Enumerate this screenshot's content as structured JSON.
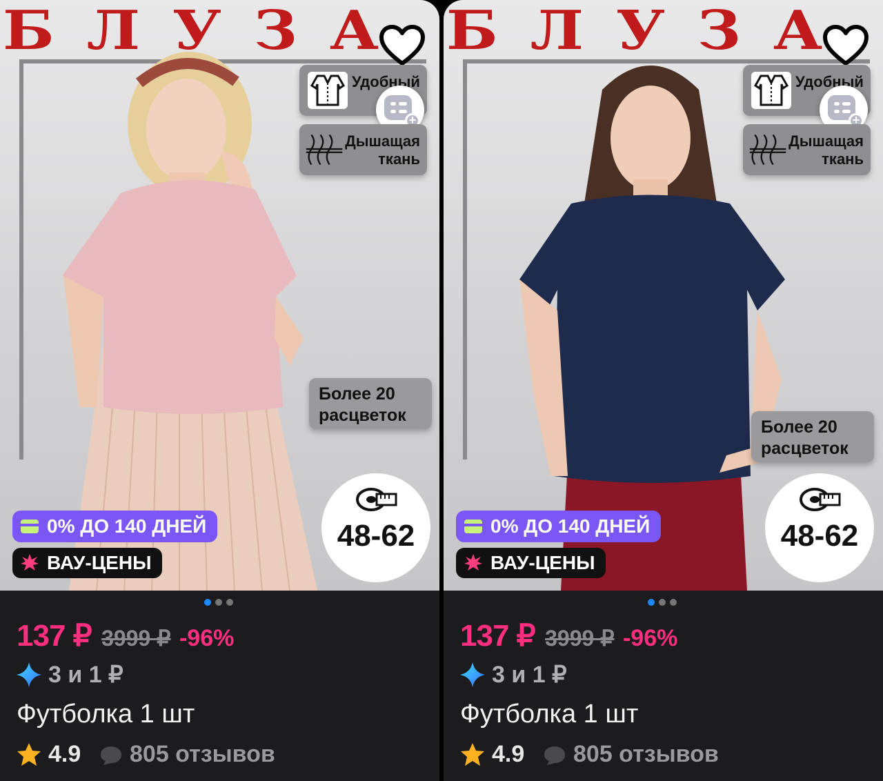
{
  "products": [
    {
      "banner_title": "БЛУЗА",
      "feature_1": "Удобный",
      "feature_2_line1": "Дышащая",
      "feature_2_line2": "ткань",
      "colors_line1": "Более 20",
      "colors_line2": "расцветок",
      "size_range": "48-62",
      "installment": "0% ДО 140 ДНЕЙ",
      "promo": "ВАУ-ЦЕНЫ",
      "price": "137 ₽",
      "old_price": "3999 ₽",
      "discount": "-96%",
      "split": "3 и 1 ₽",
      "name": "Футболка 1 шт",
      "rating": "4.9",
      "reviews": "805 отзывов",
      "shirt_color": "#e8b9bd",
      "image_index": 0,
      "image_count": 3
    },
    {
      "banner_title": "БЛУЗА",
      "feature_1": "Удобный",
      "feature_2_line1": "Дышащая",
      "feature_2_line2": "ткань",
      "colors_line1": "Более 20",
      "colors_line2": "расцветок",
      "size_range": "48-62",
      "installment": "0% ДО 140 ДНЕЙ",
      "promo": "ВАУ-ЦЕНЫ",
      "price": "137 ₽",
      "old_price": "3999 ₽",
      "discount": "-96%",
      "split": "3 и 1 ₽",
      "name": "Футболка 1 шт",
      "rating": "4.9",
      "reviews": "805 отзывов",
      "shirt_color": "#1f2b4d",
      "image_index": 0,
      "image_count": 3
    }
  ],
  "colors": {
    "price_accent": "#ff2e7e",
    "installment_bg": "#7a57f5",
    "rating_star": "#ffb21f",
    "banner_red": "#c11a1a",
    "card_bg": "#1c1c1e",
    "dot_active": "#1e88ff"
  }
}
